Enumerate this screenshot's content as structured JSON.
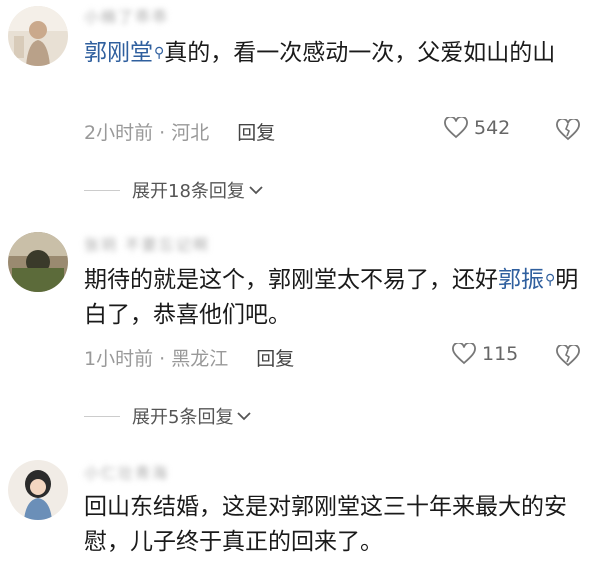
{
  "comments": [
    {
      "username": "小楠了乖乖",
      "mention": "郭刚堂",
      "text_after_mention": "真的，看一次感动一次，父爱如山的山",
      "time": "2小时前",
      "location": "河北",
      "reply_label": "回复",
      "likes": "542",
      "expand_label": "展开18条回复"
    },
    {
      "username": "张玥 不要忘记啊",
      "text_before_mention": "期待的就是这个，郭刚堂太不易了，还好",
      "mention": "郭振",
      "text_after_mention": "明白了，恭喜他们吧。",
      "time": "1小时前",
      "location": "黑龙江",
      "reply_label": "回复",
      "likes": "115",
      "expand_label": "展开5条回复"
    },
    {
      "username": "小仁壮青海",
      "text": "回山东结婚，这是对郭刚堂这三十年来最大的安慰，儿子终于真正的回来了。"
    }
  ],
  "icons": {
    "search": "search-icon",
    "heart": "heart-icon",
    "dislike": "broken-heart-icon",
    "chevron": "chevron-down-icon"
  },
  "colors": {
    "mention": "#2f5f9e",
    "meta": "#999999"
  }
}
